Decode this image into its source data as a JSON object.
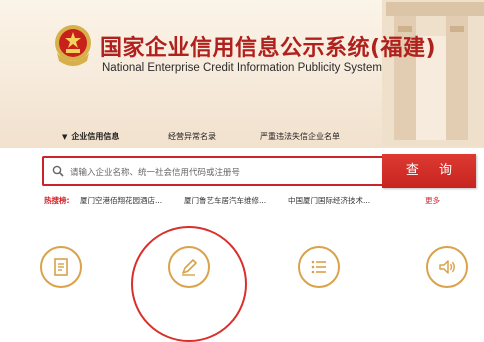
{
  "header": {
    "title": "国家企业信用信息公示系统(福建)",
    "subtitle": "National Enterprise Credit Information Publicity System"
  },
  "tabs": [
    {
      "label": "企业信用信息",
      "active": true
    },
    {
      "label": "经营异常名录",
      "active": false
    },
    {
      "label": "严重违法失信企业名单",
      "active": false
    }
  ],
  "search": {
    "placeholder": "请输入企业名称、统一社会信用代码或注册号",
    "button_label": "查 询"
  },
  "hot_search": {
    "label": "热搜榜:",
    "items": [
      "厦门空港佰翔花园酒店...",
      "厦门鲁艺车居汽车维修...",
      "中国厦门国际经济技术..."
    ],
    "more_label": "更多"
  },
  "features": [
    {
      "icon": "document-icon"
    },
    {
      "icon": "pen-icon",
      "highlighted": true
    },
    {
      "icon": "list-icon"
    },
    {
      "icon": "speaker-icon"
    }
  ],
  "colors": {
    "brand_red": "#c9252b",
    "gold": "#d9a24b"
  }
}
